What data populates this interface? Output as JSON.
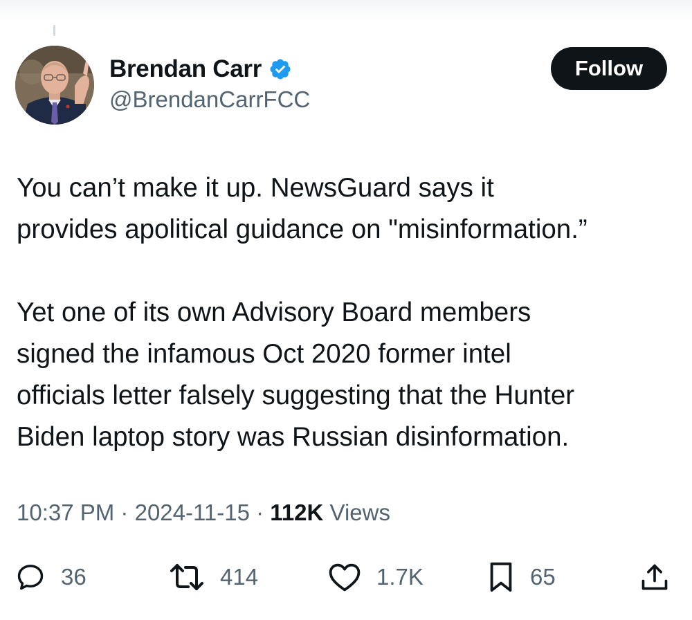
{
  "author": {
    "name": "Brendan Carr",
    "handle": "@BrendanCarrFCC",
    "verified": true,
    "accent_color": "#1d9bf0"
  },
  "follow_button": {
    "label": "Follow"
  },
  "tweet": {
    "lines_paragraph_1": [
      "You can’t make it up.  NewsGuard says it",
      "provides apolitical guidance on \"misinformation.”"
    ],
    "lines_paragraph_2": [
      "Yet one of its own Advisory Board members",
      "signed the infamous Oct 2020 former intel",
      "officials letter falsely suggesting that the Hunter",
      "Biden laptop story was Russian disinformation."
    ]
  },
  "meta": {
    "time": "10:37 PM",
    "separator": "·",
    "date": "2024-11-15",
    "views_count": "112K",
    "views_label": "Views"
  },
  "actions": {
    "reply": {
      "icon": "reply-icon",
      "count": "36"
    },
    "repost": {
      "icon": "repost-icon",
      "count": "414"
    },
    "like": {
      "icon": "heart-icon",
      "count": "1.7K"
    },
    "bookmark": {
      "icon": "bookmark-icon",
      "count": "65"
    },
    "share": {
      "icon": "share-icon"
    }
  }
}
